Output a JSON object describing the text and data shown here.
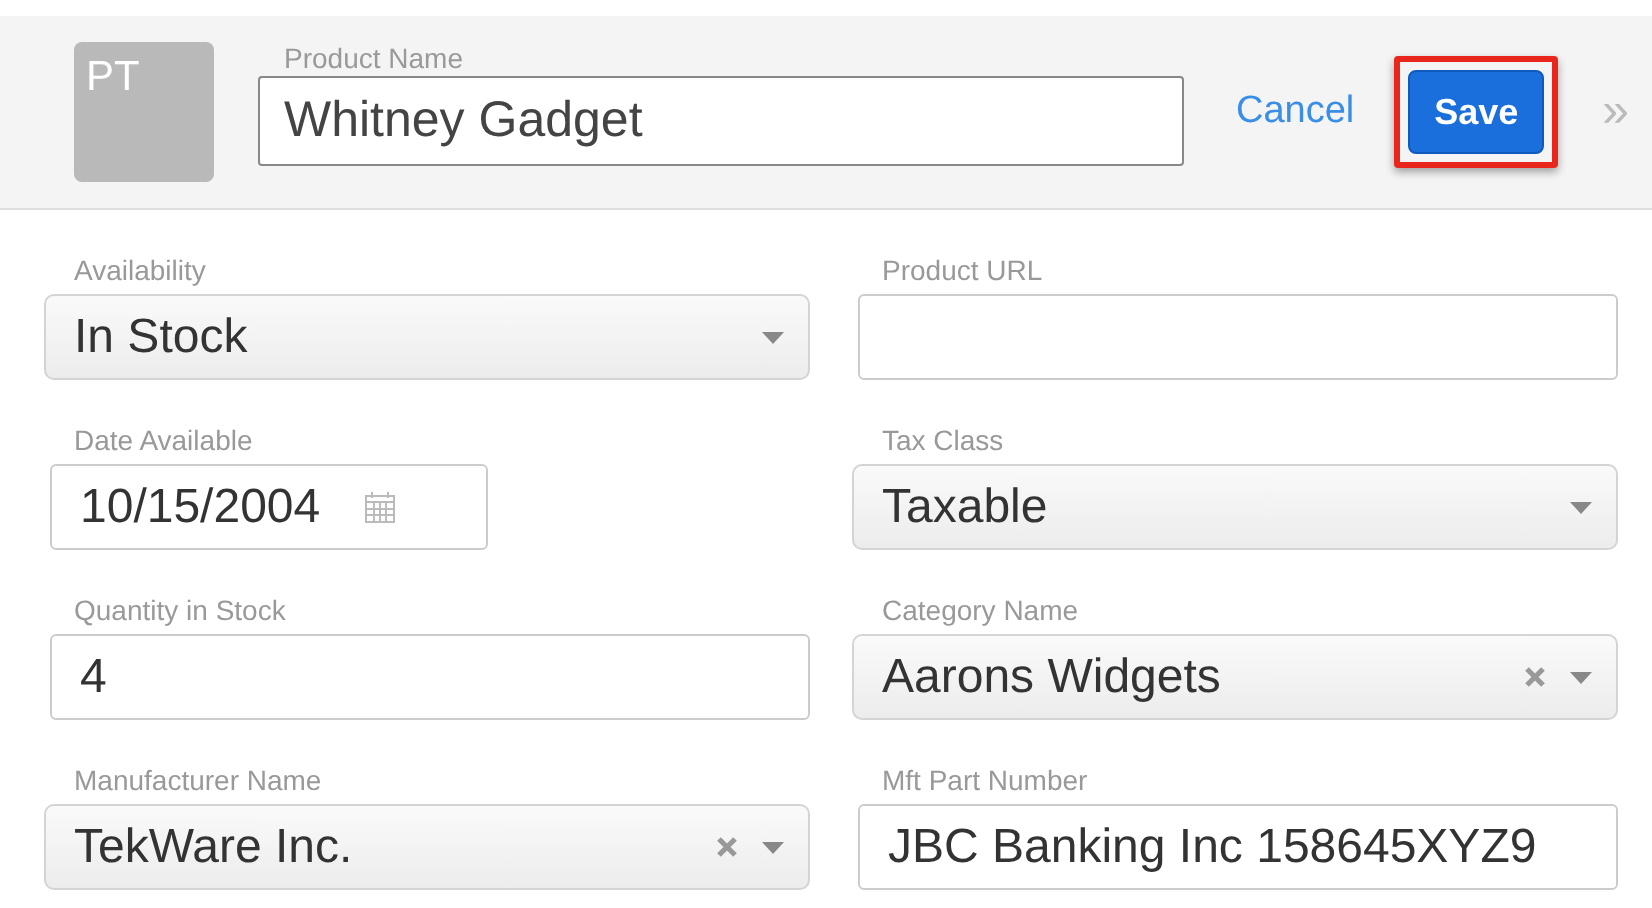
{
  "header": {
    "avatar": "PT",
    "product_name": {
      "label": "Product Name",
      "value": "Whitney Gadget"
    },
    "cancel": "Cancel",
    "save": {
      "label": "Save",
      "highlighted": true
    },
    "more": "»"
  },
  "fields": [
    {
      "label": "Availability",
      "kind": "select",
      "value": "In Stock"
    },
    {
      "label": "Product URL",
      "kind": "text"
    },
    {
      "label": "Date Available",
      "kind": "date",
      "value": "10/15/2004"
    },
    {
      "label": "Tax Class",
      "kind": "select",
      "value": "Taxable"
    },
    {
      "label": "Quantity in Stock",
      "kind": "text",
      "value": "4"
    },
    {
      "label": "Category Name",
      "kind": "select-clear",
      "value": "Aarons Widgets"
    },
    {
      "label": "Manufacturer Name",
      "kind": "select-clear",
      "value": "TekWare Inc."
    },
    {
      "label": "Mft Part Number",
      "kind": "text",
      "value": "JBC Banking Inc 158645XYZ9"
    }
  ]
}
